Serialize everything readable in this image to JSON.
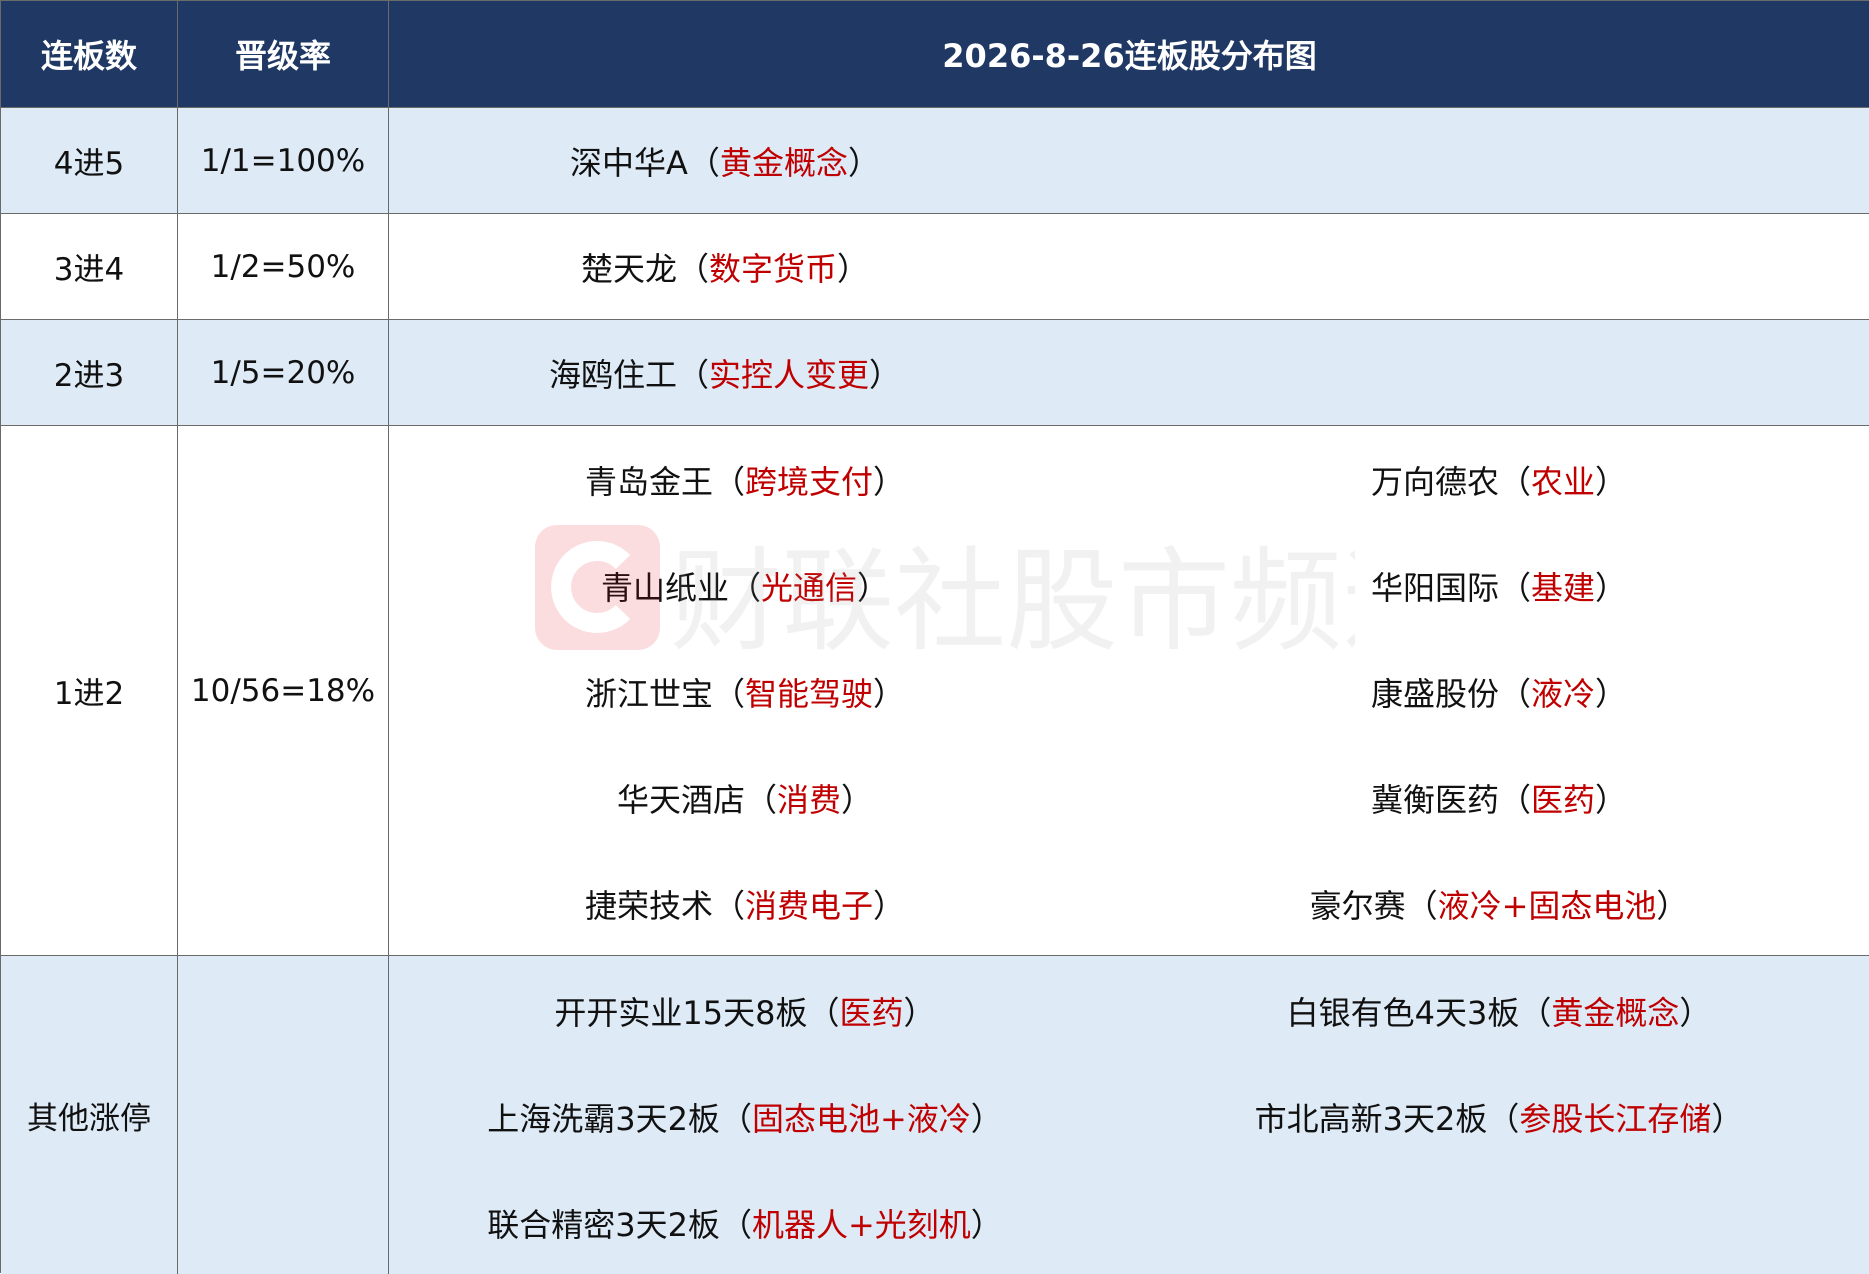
{
  "header": {
    "col1": "连板数",
    "col2": "晋级率",
    "col3": "2026-8-26连板股分布图"
  },
  "rows": {
    "r45": {
      "level": "4进5",
      "rate": "1/1=100%",
      "s1_name": "深中华A",
      "s1_tag": "黄金概念"
    },
    "r34": {
      "level": "3进4",
      "rate": "1/2=50%",
      "s1_name": "楚天龙",
      "s1_tag": "数字货币"
    },
    "r23": {
      "level": "2进3",
      "rate": "1/5=20%",
      "s1_name": "海鸥住工",
      "s1_tag": "实控人变更"
    },
    "r12": {
      "level": "1进2",
      "rate": "10/56=18%",
      "left": [
        {
          "name": "青岛金王",
          "tag": "跨境支付"
        },
        {
          "name": "青山纸业",
          "tag": "光通信"
        },
        {
          "name": "浙江世宝",
          "tag": "智能驾驶"
        },
        {
          "name": "华天酒店",
          "tag": "消费"
        },
        {
          "name": "捷荣技术",
          "tag": "消费电子"
        }
      ],
      "right": [
        {
          "name": "万向德农",
          "tag": "农业"
        },
        {
          "name": "华阳国际",
          "tag": "基建"
        },
        {
          "name": "康盛股份",
          "tag": "液冷"
        },
        {
          "name": "冀衡医药",
          "tag": "医药"
        },
        {
          "name": "豪尔赛",
          "tag": "液冷+固态电池"
        }
      ]
    },
    "other": {
      "level": "其他涨停",
      "rate": "",
      "left": [
        {
          "name": "开开实业15天8板",
          "tag": "医药"
        },
        {
          "name": "上海洗霸3天2板",
          "tag": "固态电池+液冷"
        },
        {
          "name": "联合精密3天2板",
          "tag": "机器人+光刻机"
        }
      ],
      "right": [
        {
          "name": "白银有色4天3板",
          "tag": "黄金概念"
        },
        {
          "name": "市北高新3天2板",
          "tag": "参股长江存储"
        }
      ]
    }
  },
  "punct": {
    "open": "（",
    "close": "）"
  },
  "watermark": {
    "text": "财联社股市频道",
    "icon": "cls-logo-icon"
  },
  "colors": {
    "header_bg": "#1f3864",
    "band_bg": "#deebf7",
    "tag_color": "#c00000",
    "border": "#6a6a6a"
  }
}
